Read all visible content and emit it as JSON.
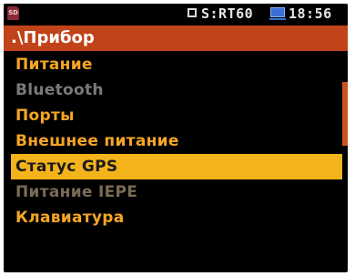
{
  "status": {
    "mode": "S:RT60",
    "time": "18:56",
    "sd_icon": "sd-card-icon",
    "display_icon": "display-icon"
  },
  "header": {
    "title": ".\\Прибор"
  },
  "menu": {
    "items": [
      {
        "label": "Питание",
        "state": "enabled"
      },
      {
        "label": "Bluetooth",
        "state": "disabled"
      },
      {
        "label": "Порты",
        "state": "enabled"
      },
      {
        "label": "Внешнее питание",
        "state": "enabled"
      },
      {
        "label": "Статус GPS",
        "state": "selected"
      },
      {
        "label": "Питание IEPE",
        "state": "disabled"
      },
      {
        "label": "Клавиатура",
        "state": "enabled"
      }
    ]
  },
  "colors": {
    "title_bar": "#c1431a",
    "item_text": "#f5a623",
    "selected_bg": "#f3b31a",
    "disabled_text": "#7a7a7a"
  }
}
